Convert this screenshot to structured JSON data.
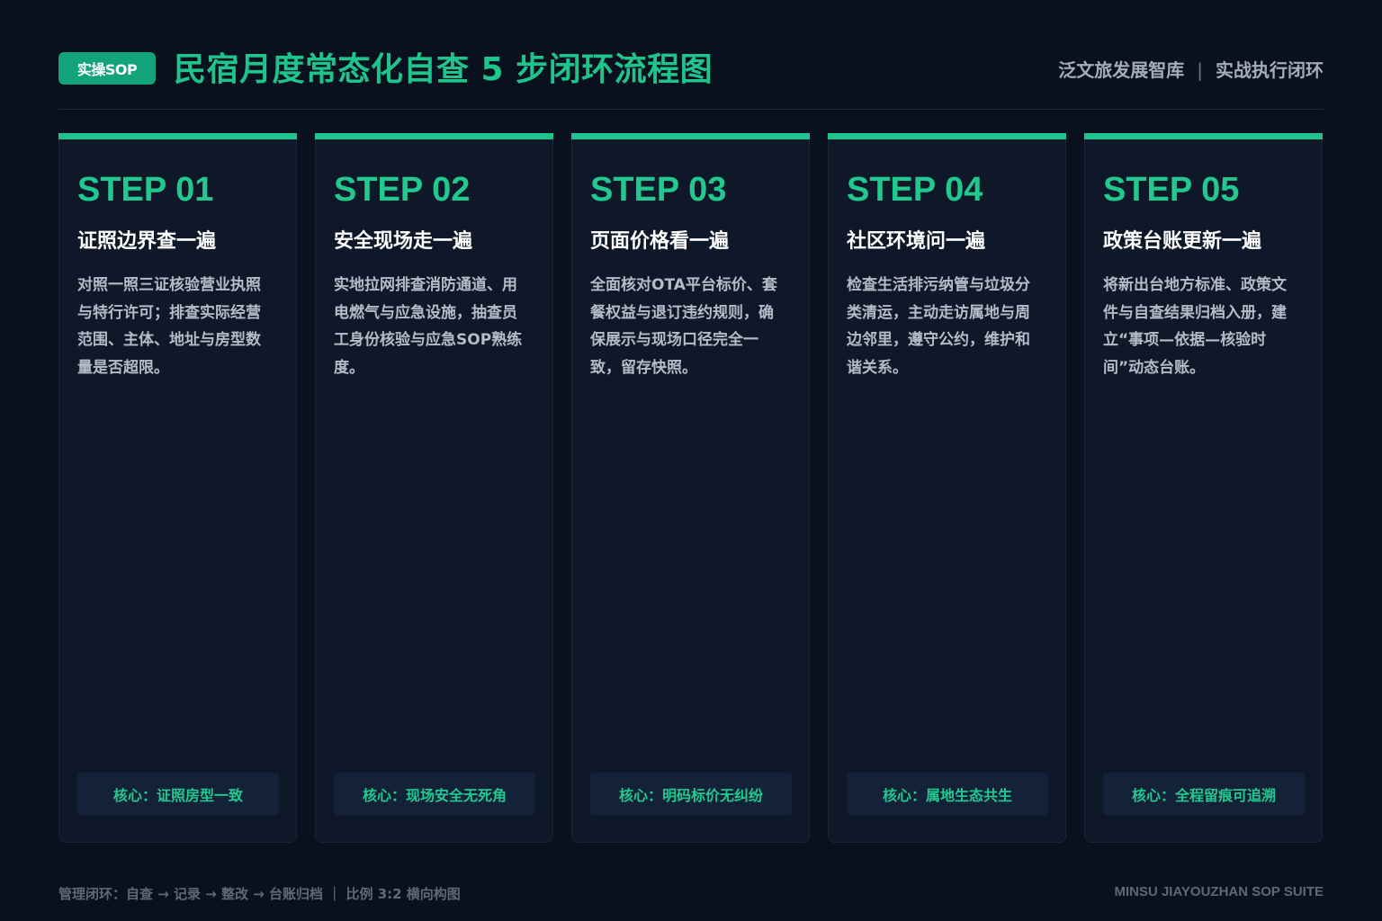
{
  "header": {
    "tag": "实操SOP",
    "title": "民宿月度常态化自查 5 步闭环流程图",
    "brand_left": "泛文旅发展智库",
    "brand_sep": "|",
    "brand_right": "实战执行闭环"
  },
  "colors": {
    "background": "#0a111e",
    "accent": "#1fc48c",
    "card": "#0e1828",
    "core_box": "#142239"
  },
  "steps": [
    {
      "label": "STEP 01",
      "title": "证照边界查一遍",
      "desc": "对照一照三证核验营业执照与特行许可；排查实际经营范围、主体、地址与房型数量是否超限。",
      "core": "核心：证照房型一致"
    },
    {
      "label": "STEP 02",
      "title": "安全现场走一遍",
      "desc": "实地拉网排查消防通道、用电燃气与应急设施，抽查员工身份核验与应急SOP熟练度。",
      "core": "核心：现场安全无死角"
    },
    {
      "label": "STEP 03",
      "title": "页面价格看一遍",
      "desc": "全面核对OTA平台标价、套餐权益与退订违约规则，确保展示与现场口径完全一致，留存快照。",
      "core": "核心：明码标价无纠纷"
    },
    {
      "label": "STEP 04",
      "title": "社区环境问一遍",
      "desc": "检查生活排污纳管与垃圾分类清运，主动走访属地与周边邻里，遵守公约，维护和谐关系。",
      "core": "核心：属地生态共生"
    },
    {
      "label": "STEP 05",
      "title": "政策台账更新一遍",
      "desc": "将新出台地方标准、政策文件与自查结果归档入册，建立“事项—依据—核验时间”动态台账。",
      "core": "核心：全程留痕可追溯"
    }
  ],
  "footer": {
    "left": "管理闭环：自查 → 记录 → 整改 → 台账归档 ｜ 比例 3:2 横向构图",
    "right": "MINSU JIAYOUZHAN SOP SUITE"
  }
}
